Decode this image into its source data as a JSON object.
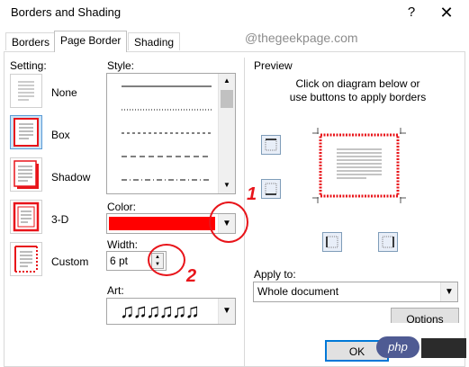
{
  "window": {
    "title": "Borders and Shading",
    "help_glyph": "?",
    "close_glyph": "✕"
  },
  "tabs": [
    {
      "label": "Borders"
    },
    {
      "label": "Page Border"
    },
    {
      "label": "Shading"
    }
  ],
  "setting": {
    "label": "Setting:",
    "options": [
      {
        "label": "None"
      },
      {
        "label": "Box"
      },
      {
        "label": "Shadow"
      },
      {
        "label": "3-D"
      },
      {
        "label": "Custom"
      }
    ],
    "selected": "Box"
  },
  "style": {
    "label": "Style:"
  },
  "color": {
    "label": "Color:",
    "value": "#ff0000"
  },
  "width": {
    "label": "Width:",
    "value": "6 pt"
  },
  "art": {
    "label": "Art:",
    "value": "♫♫♫♫♫♫"
  },
  "preview": {
    "label": "Preview",
    "instructions_line1": "Click on diagram below or",
    "instructions_line2": "use buttons to apply borders"
  },
  "apply_to": {
    "label": "Apply to:",
    "value": "Whole document"
  },
  "buttons": {
    "options": "Options",
    "ok": "OK"
  },
  "watermark": "@thegeekpage.com",
  "annotations": [
    "1",
    "2"
  ],
  "overlay_badge": "php",
  "colors": {
    "accent": "#ff0000",
    "annotation": "#e8141a",
    "selection": "#cce4f7"
  }
}
